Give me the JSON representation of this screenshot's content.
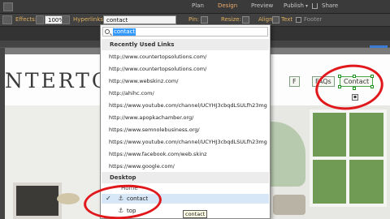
{
  "menu": {
    "items": [
      "Plan",
      "Design",
      "Preview",
      "Publish",
      "Share"
    ],
    "active": "Design",
    "publish_arrow": "▾"
  },
  "controlbar": {
    "effects_label": "Effects:",
    "opacity_value": "100%",
    "hyperlinks_label": "Hyperlinks:",
    "hyperlinks_value": "contact",
    "pin_label": "Pin:",
    "resize_label": "Resize:",
    "align_label": "Align:",
    "text_label": "Text",
    "footer_label": "Footer"
  },
  "dropdown": {
    "search_value": "contact",
    "recent_header": "Recently Used Links",
    "recent_links": [
      "http://www.countertopsolutions.com/",
      "http://www.countertopsolutions.com/",
      "http://www.webskinz.com/",
      "http://ahihc.com/",
      "https://www.youtube.com/channel/UCYHJ3cbqdLSULfh23mgRIAg/videos",
      "http://www.apopkachamber.org/",
      "https://www.semnolebusiness.org/",
      "https://www.youtube.com/channel/UCYHJ3cbqdLSULfh23mgRIAg",
      "https://www.facebook.com/web.skinz",
      "https://www.google.com/"
    ],
    "desktop_header": "Desktop",
    "home_label": "Home",
    "anchors": [
      {
        "label": "contact",
        "selected": true
      },
      {
        "label": "top",
        "selected": false
      }
    ],
    "check_mark": "✓",
    "anchor_icon": "⚓"
  },
  "tooltip": "contact",
  "site": {
    "logo_text": "NTERTOPS S",
    "nav": [
      "FAQs",
      "Contact"
    ],
    "nav_partial": "F"
  },
  "colors": {
    "accent": "#e9a96a",
    "annotation": "#e0181c",
    "selection": "#3399ff"
  }
}
